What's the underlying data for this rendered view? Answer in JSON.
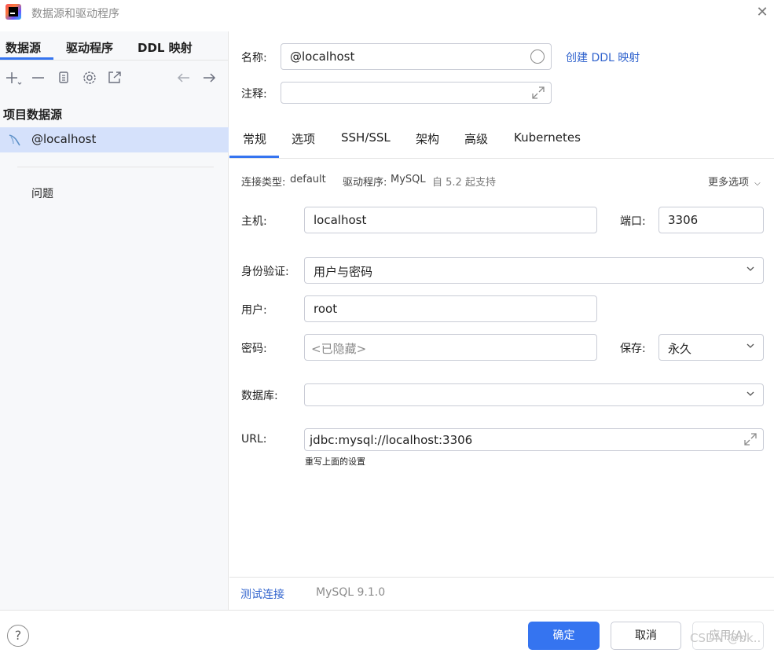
{
  "window": {
    "title": "数据源和驱动程序"
  },
  "left": {
    "tabs": [
      "数据源",
      "驱动程序",
      "DDL 映射"
    ],
    "section_title": "项目数据源",
    "datasource": "@localhost",
    "problems": "问题"
  },
  "form": {
    "name_label": "名称:",
    "name_value": "@localhost",
    "create_ddl_link": "创建 DDL 映射",
    "comment_label": "注释:",
    "comment_value": "",
    "tabs": [
      "常规",
      "选项",
      "SSH/SSL",
      "架构",
      "高级",
      "Kubernetes"
    ],
    "conn_type_label": "连接类型:",
    "conn_type_value": "default",
    "driver_label": "驱动程序:",
    "driver_value": "MySQL",
    "driver_note": "自 5.2 起支持",
    "more_options": "更多选项",
    "host_label": "主机:",
    "host_value": "localhost",
    "port_label": "端口:",
    "port_value": "3306",
    "auth_label": "身份验证:",
    "auth_value": "用户与密码",
    "user_label": "用户:",
    "user_value": "root",
    "password_label": "密码:",
    "password_placeholder": "<已隐藏>",
    "save_label": "保存:",
    "save_value": "永久",
    "database_label": "数据库:",
    "database_value": "",
    "url_label": "URL:",
    "url_value": "jdbc:mysql://localhost:3306",
    "url_hint": "重写上面的设置"
  },
  "footer": {
    "test_connection": "测试连接",
    "mysql_version": "MySQL 9.1.0",
    "help": "?",
    "ok": "确定",
    "cancel": "取消",
    "apply": "应用(A)",
    "watermark": "CSDN @bk.."
  },
  "colors": {
    "accent": "#3574f0",
    "link": "#2f62cd",
    "selection": "#d5e1fb"
  }
}
